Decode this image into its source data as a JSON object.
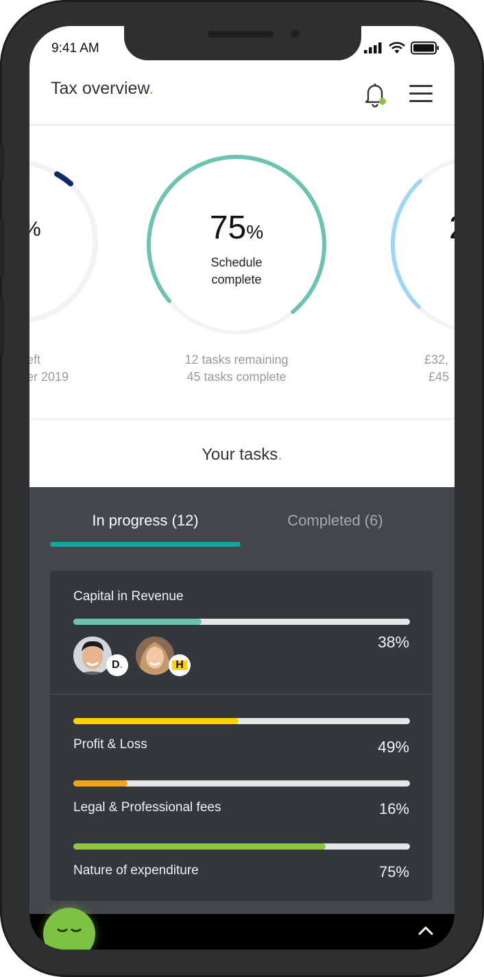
{
  "status": {
    "time": "9:41 AM"
  },
  "header": {
    "title": "Tax overview",
    "title_dot": "."
  },
  "carousel": {
    "left": {
      "pct_fragment": "%",
      "line1": "eft",
      "line2": "er 2019"
    },
    "center": {
      "value": "75",
      "unit": "%",
      "label_line1": "Schedule",
      "label_line2": "complete",
      "progress": 0.75,
      "sub1": "12 tasks remaining",
      "sub2": "45 tasks complete"
    },
    "right": {
      "value_fragment": "2",
      "line1": "£32,",
      "line2": "£45"
    }
  },
  "tasks": {
    "title": "Your tasks",
    "title_dot": "."
  },
  "tabs": [
    {
      "label": "In progress (12)",
      "active": true
    },
    {
      "label": "Completed (6)",
      "active": false
    }
  ],
  "items": [
    {
      "name": "Capital in Revenue",
      "percent": "38%",
      "progress": 0.38,
      "color": "#6cc3b2",
      "assignees": [
        {
          "initial": "D"
        },
        {
          "initial": "H"
        }
      ]
    },
    {
      "name": "Profit & Loss",
      "percent": "49%",
      "progress": 0.49,
      "color": "#ffd200"
    },
    {
      "name": "Legal & Professional fees",
      "percent": "16%",
      "progress": 0.16,
      "color": "#f7a21b"
    },
    {
      "name": "Nature of expenditure",
      "percent": "75%",
      "progress": 0.75,
      "color": "#8dc63f"
    }
  ],
  "colors": {
    "accent_green": "#8cc63f",
    "tab_underline": "#14a4a6",
    "ring_center": "#6cc3b2",
    "ring_right": "#9ed6f5",
    "ring_left": "#0d2b6b"
  }
}
